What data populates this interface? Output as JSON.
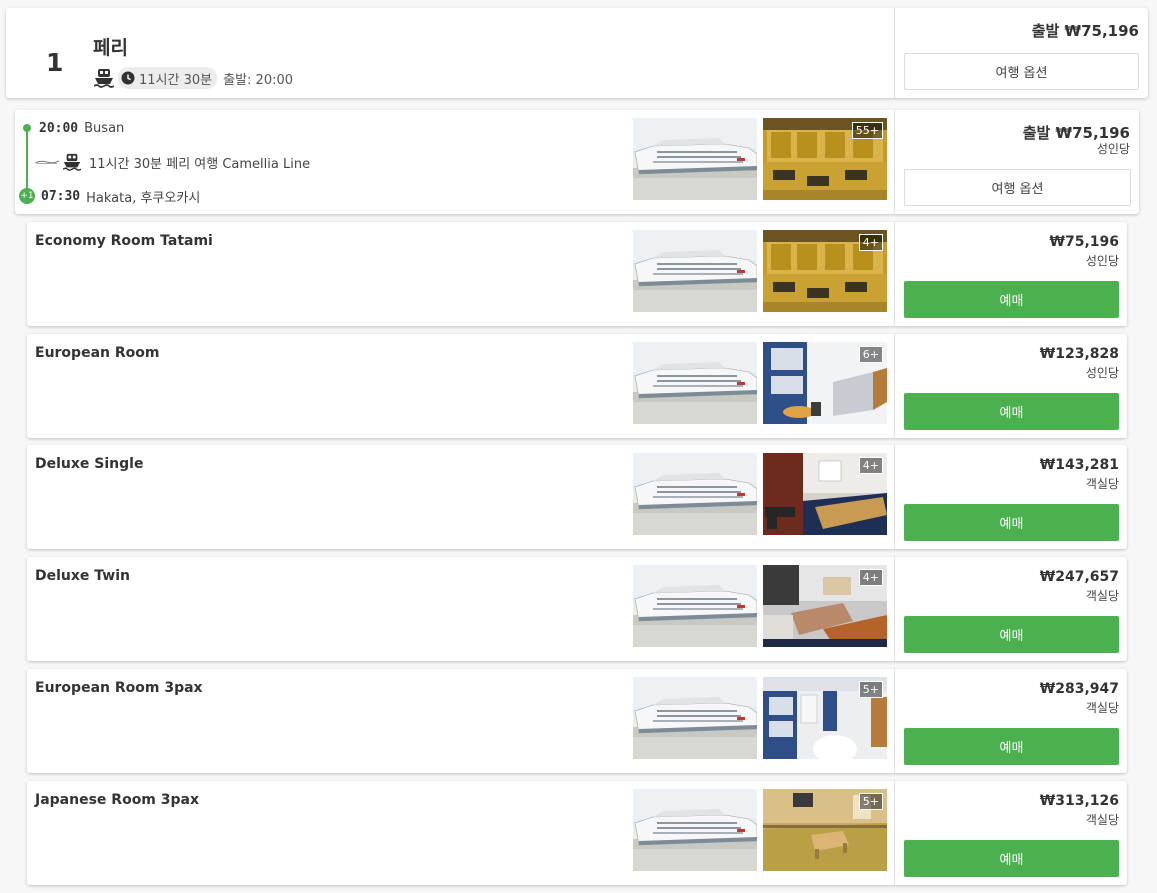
{
  "summary": {
    "index": "1",
    "mode": "페리",
    "duration": "11시간 30분",
    "depart": "출발: 20:00",
    "price": "출발 ₩75,196",
    "options_label": "여행 옵션",
    "ferry_icon": "ferry-icon",
    "clock_icon": "clock-icon"
  },
  "route": {
    "depart_time": "20:00",
    "depart_place": "Busan",
    "trip_desc": "11시간 30분 페리 여행 Camellia Line",
    "day_offset": "+1",
    "arrive_time": "07:30",
    "arrive_place": "Hakata, 후쿠오카시",
    "price": "출발 ₩75,196",
    "per": "성인당",
    "options_label": "여행 옵션",
    "photo_count": "55+",
    "accent": "#4caf50"
  },
  "rooms": [
    {
      "name": "Economy Room Tatami",
      "price": "₩75,196",
      "per": "성인당",
      "count": "4+",
      "book": "예매"
    },
    {
      "name": "European Room",
      "price": "₩123,828",
      "per": "성인당",
      "count": "6+",
      "book": "예매"
    },
    {
      "name": "Deluxe Single",
      "price": "₩143,281",
      "per": "객실당",
      "count": "4+",
      "book": "예매"
    },
    {
      "name": "Deluxe Twin",
      "price": "₩247,657",
      "per": "객실당",
      "count": "4+",
      "book": "예매"
    },
    {
      "name": "European Room 3pax",
      "price": "₩283,947",
      "per": "객실당",
      "count": "5+",
      "book": "예매"
    },
    {
      "name": "Japanese Room 3pax",
      "price": "₩313,126",
      "per": "객실당",
      "count": "5+",
      "book": "예매"
    }
  ],
  "colors": {
    "book_button": "#4caf50",
    "text": "#333333"
  }
}
